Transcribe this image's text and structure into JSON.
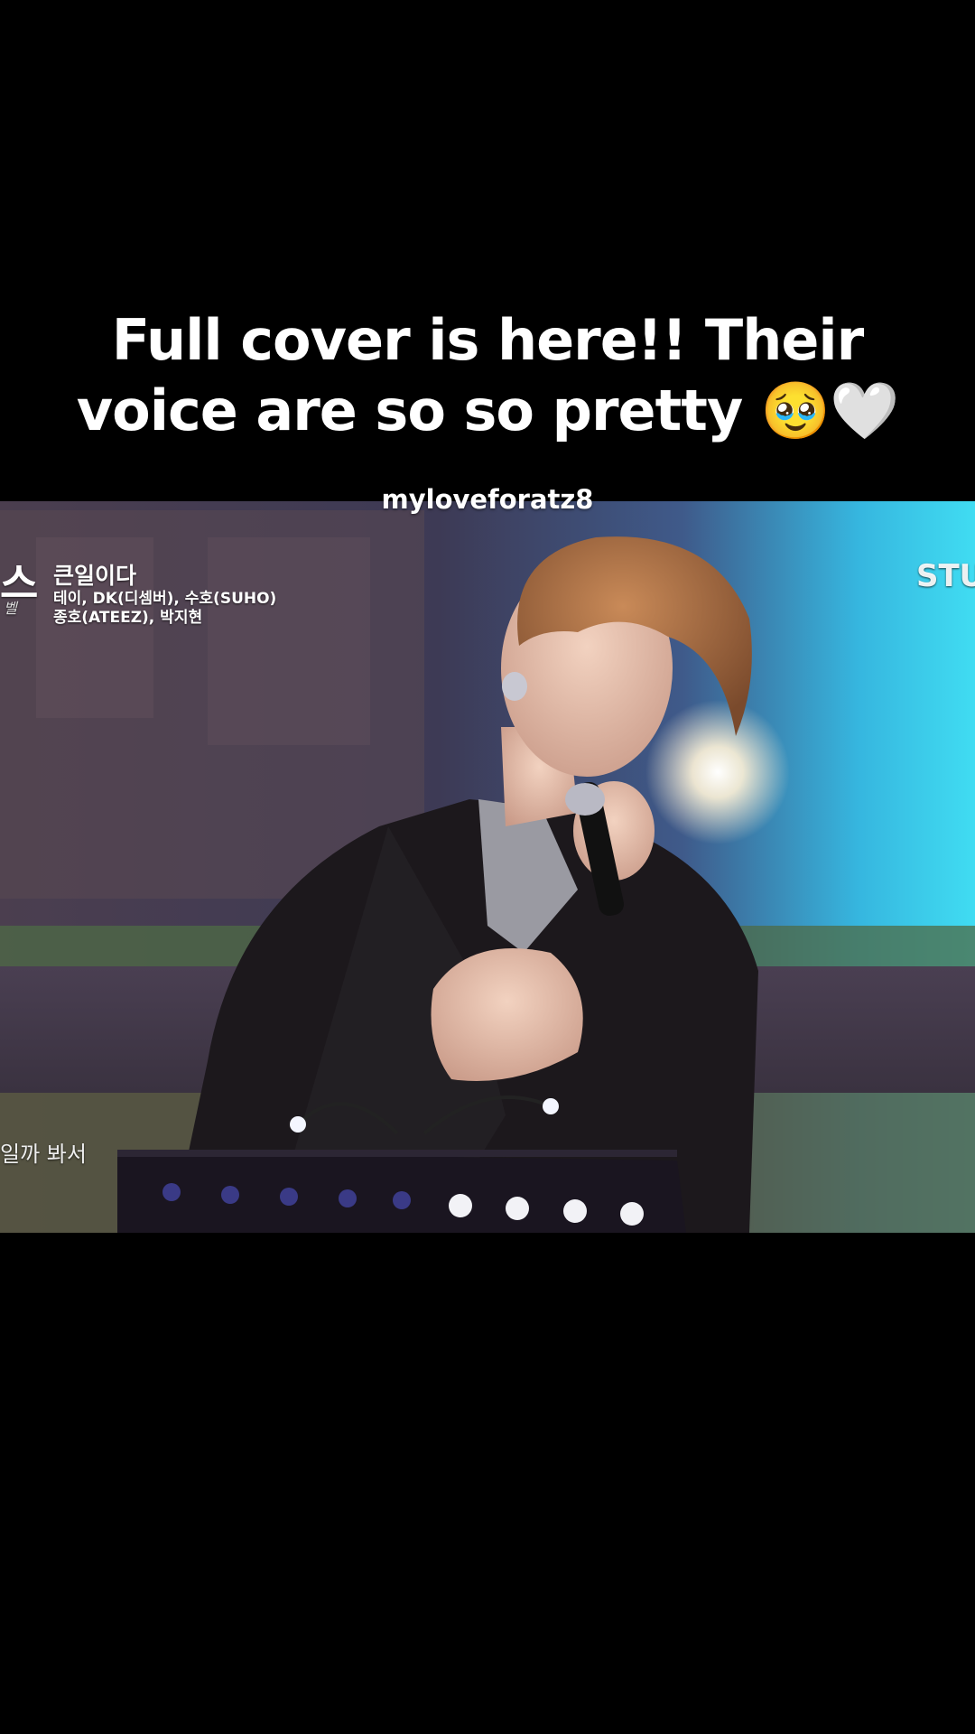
{
  "post": {
    "caption_line1": "Full cover is here!! Their",
    "caption_line2": "voice are so so pretty ",
    "caption_emojis": "🥹🤍",
    "username": "myloveforatz8"
  },
  "video_overlay": {
    "show_logo": "스",
    "show_logo_sub": "벨",
    "song_title": "큰일이다",
    "artists_line1": "테이, DK(디셈버), 수호(SUHO)",
    "artists_line2": "종호(ATEEZ), 박지현",
    "studio_mark": "STU",
    "lyric": "일까 봐서"
  },
  "colors": {
    "background": "#000000",
    "caption_text": "#ffffff",
    "stage_light": "#38d4f0",
    "backdrop": "#4a3f52"
  }
}
